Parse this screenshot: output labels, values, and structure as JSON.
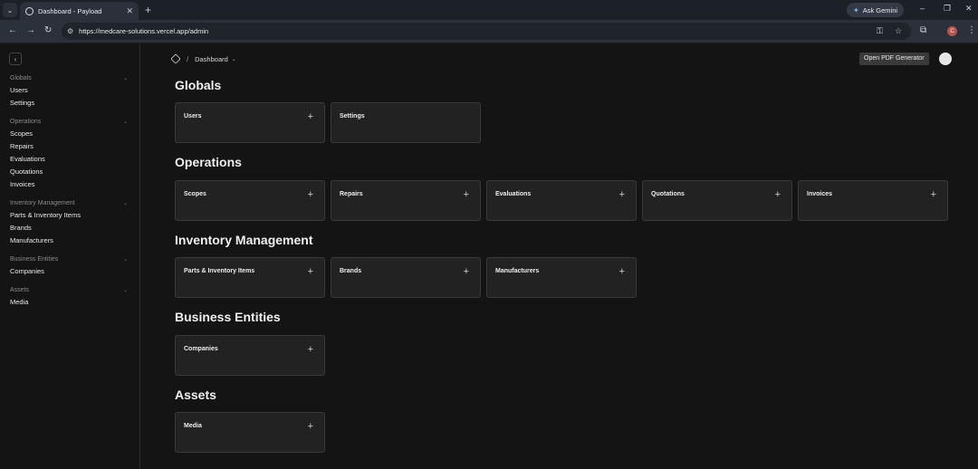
{
  "browser": {
    "tab_title": "Dashboard - Payload",
    "url": "https://medcare-solutions.vercel.app/admin",
    "gemini_label": "Ask Gemini",
    "profile_initial": "C"
  },
  "breadcrumb": {
    "page": "Dashboard"
  },
  "header": {
    "pdf_button": "Open PDF Generator"
  },
  "sidebar": {
    "groups": [
      {
        "title": "Globals",
        "items": [
          "Users",
          "Settings"
        ]
      },
      {
        "title": "Operations",
        "items": [
          "Scopes",
          "Repairs",
          "Evaluations",
          "Quotations",
          "Invoices"
        ]
      },
      {
        "title": "Inventory Management",
        "items": [
          "Parts & Inventory Items",
          "Brands",
          "Manufacturers"
        ]
      },
      {
        "title": "Business Entities",
        "items": [
          "Companies"
        ]
      },
      {
        "title": "Assets",
        "items": [
          "Media"
        ]
      }
    ]
  },
  "sections": [
    {
      "title": "Globals",
      "cards": [
        "Users",
        "Settings"
      ]
    },
    {
      "title": "Operations",
      "cards": [
        "Scopes",
        "Repairs",
        "Evaluations",
        "Quotations",
        "Invoices"
      ]
    },
    {
      "title": "Inventory Management",
      "cards": [
        "Parts & Inventory Items",
        "Brands",
        "Manufacturers"
      ]
    },
    {
      "title": "Business Entities",
      "cards": [
        "Companies"
      ]
    },
    {
      "title": "Assets",
      "cards": [
        "Media"
      ]
    }
  ],
  "icons": {
    "plus": "+",
    "close": "✕",
    "chevron": "⌄"
  }
}
